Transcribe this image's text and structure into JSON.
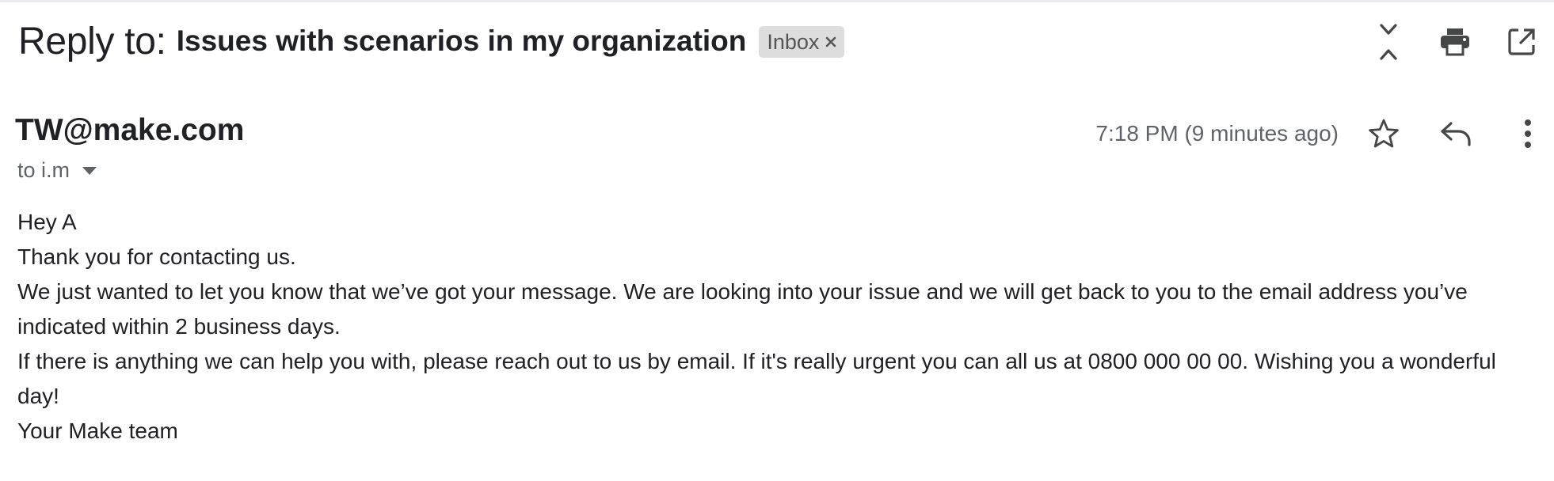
{
  "header": {
    "reply_prefix": "Reply to:",
    "subject": "Issues with scenarios in my organization",
    "label": "Inbox",
    "actions": [
      {
        "name": "collapse-all-icon"
      },
      {
        "name": "print-icon"
      },
      {
        "name": "open-new-window-icon"
      }
    ]
  },
  "sender": {
    "name": "TW@make.com",
    "recipient": "to i.m",
    "timestamp": "7:18 PM (9 minutes ago)",
    "actions": [
      {
        "name": "star-icon"
      },
      {
        "name": "reply-icon"
      },
      {
        "name": "more-vert-icon"
      }
    ]
  },
  "body": {
    "lines": [
      "Hey A",
      "Thank you for contacting us.",
      "We just wanted to let you know that we’ve got your message. We are looking into your issue and we will get back to you to the email address you’ve indicated within 2 business days.",
      "If there is anything we can help you with, please reach out to us by email. If it's really urgent you can all us at 0800 000 00 00. Wishing you a wonderful day!",
      "Your Make team"
    ]
  },
  "colors": {
    "text_primary": "#202124",
    "text_secondary": "#5f6368",
    "chip_bg": "#dddddd",
    "icon": "#444746"
  }
}
